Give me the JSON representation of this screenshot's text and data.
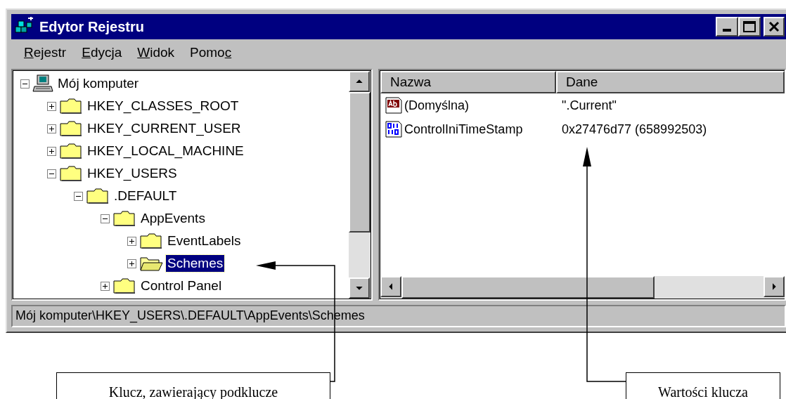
{
  "window": {
    "title": "Edytor Rejestru"
  },
  "menu": [
    {
      "key": "R",
      "post": "ejestr"
    },
    {
      "key": "E",
      "post": "dycja"
    },
    {
      "key": "W",
      "post": "idok"
    },
    {
      "pre": "Pomo",
      "key": "c"
    }
  ],
  "tree": {
    "label": "Mój komputer",
    "kind": "computer",
    "expanded": true,
    "selected": false,
    "children": [
      {
        "label": "HKEY_CLASSES_ROOT",
        "kind": "folder",
        "expanded": false,
        "selected": false
      },
      {
        "label": "HKEY_CURRENT_USER",
        "kind": "folder",
        "expanded": false,
        "selected": false
      },
      {
        "label": "HKEY_LOCAL_MACHINE",
        "kind": "folder",
        "expanded": false,
        "selected": false
      },
      {
        "label": "HKEY_USERS",
        "kind": "folder",
        "expanded": true,
        "selected": false,
        "children": [
          {
            "label": ".DEFAULT",
            "kind": "folder",
            "expanded": true,
            "selected": false,
            "children": [
              {
                "label": "AppEvents",
                "kind": "folder",
                "expanded": true,
                "selected": false,
                "children": [
                  {
                    "label": "EventLabels",
                    "kind": "folder",
                    "expanded": false,
                    "selected": false
                  },
                  {
                    "label": "Schemes",
                    "kind": "folder",
                    "expanded": false,
                    "selected": true
                  }
                ]
              },
              {
                "label": "Control Panel",
                "kind": "folder",
                "expanded": false,
                "selected": false
              }
            ]
          }
        ]
      }
    ]
  },
  "values": {
    "columns": [
      "Nazwa",
      "Dane"
    ],
    "rows": [
      {
        "kind": "string",
        "name": "(Domyślna)",
        "data": "\".Current\""
      },
      {
        "kind": "binary",
        "name": "ControlIniTimeStamp",
        "data": "0x27476d77 (658992503)"
      }
    ]
  },
  "status_bar": "Mój komputer\\HKEY_USERS\\.DEFAULT\\AppEvents\\Schemes",
  "callouts": [
    {
      "text": "Klucz, zawierający podklucze"
    },
    {
      "text": "Wartości klucza"
    }
  ]
}
